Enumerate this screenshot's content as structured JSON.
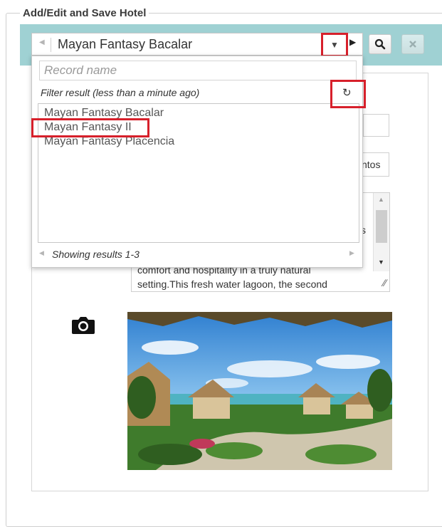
{
  "panel": {
    "legend": "Add/Edit and Save Hotel"
  },
  "combo": {
    "selected_value": "Mayan Fantasy Bacalar"
  },
  "popup": {
    "search_placeholder": "Record name",
    "filter_text": "Filter result (less than a minute ago)",
    "results": [
      "Mayan Fantasy Bacalar",
      "Mayan Fantasy II",
      "Mayan Fantasy Placencia"
    ],
    "footer_text": "Showing results 1-3"
  },
  "background_fields": {
    "partial_text": "ntos",
    "partial_letter": "s",
    "description_lines": [
      "comfort and hospitality in a truly natural",
      "setting.This fresh water lagoon, the second"
    ]
  },
  "icons": {
    "left_arrow": "left-arrow-icon",
    "dropdown": "chevron-down-icon",
    "next": "right-arrow-icon",
    "search": "search-icon",
    "clear": "close-icon",
    "refresh": "refresh-icon",
    "camera": "camera-icon",
    "resize": "resize-grip-icon"
  },
  "colors": {
    "highlight_box": "#d7202b",
    "toolbar_bg": "#9fd1d3"
  }
}
